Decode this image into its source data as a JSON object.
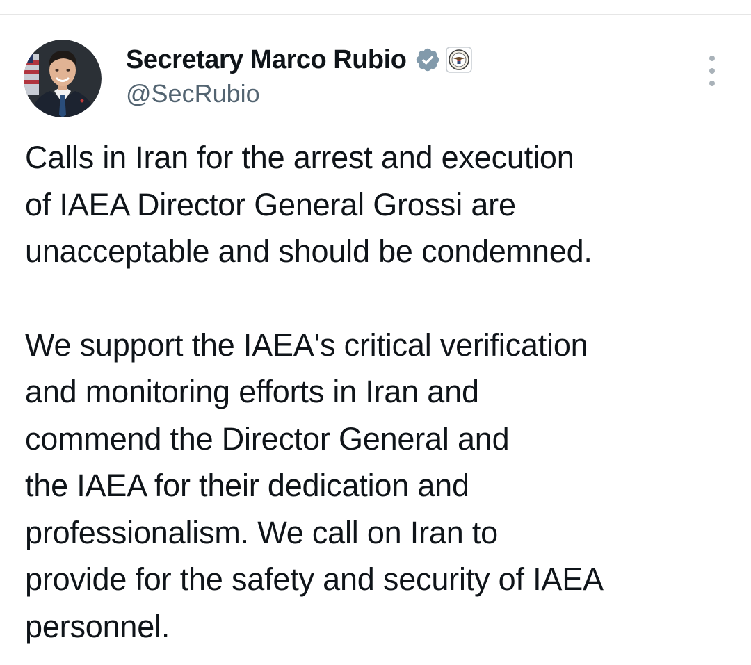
{
  "author": {
    "display_name": "Secretary Marco Rubio",
    "handle": "@SecRubio",
    "verified": true,
    "badges": [
      "verified-badge-icon",
      "government-seal-icon"
    ],
    "avatar": "avatar-photo"
  },
  "menu": {
    "icon": "more-options-icon"
  },
  "tweet": {
    "paragraph1": [
      "Calls in Iran for the arrest and execution",
      "of IAEA Director General Grossi are",
      "unacceptable and should be condemned."
    ],
    "paragraph2": [
      "We support the IAEA's critical verification",
      "and monitoring efforts in Iran and",
      "commend the Director General and",
      "the IAEA for their dedication and",
      "professionalism. We call on Iran to",
      "provide for the safety and security of IAEA",
      "personnel."
    ]
  },
  "colors": {
    "text": "#0f1419",
    "secondary_text": "#536471",
    "verified_badge": "#829aab",
    "divider": "#e6e6e6"
  }
}
